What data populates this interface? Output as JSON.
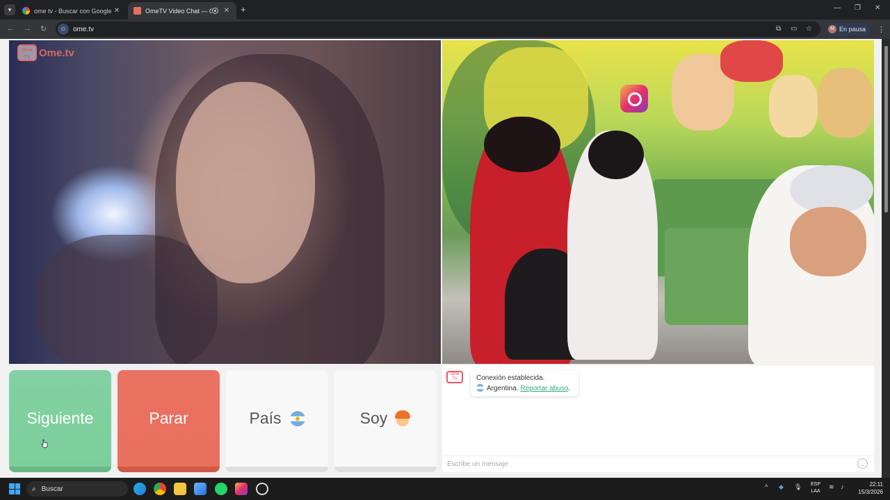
{
  "browser": {
    "tabs": [
      {
        "title": "ome tv - Buscar con Google",
        "active": false
      },
      {
        "title": "OmeTV Video Chat — Ome",
        "active": true
      }
    ],
    "url": "ome.tv",
    "profile_label": "En pausa",
    "profile_initial": "M"
  },
  "site": {
    "logo_text": "Ome.tv",
    "logo_badge": "Ome TV"
  },
  "controls": {
    "next_label": "Siguiente",
    "stop_label": "Parar",
    "country_label": "País",
    "gender_label": "Soy"
  },
  "chat": {
    "connection_text": "Conexión establecida.",
    "country_text": "Argentina.",
    "report_link": "Reportar abuso",
    "report_suffix": ".",
    "input_placeholder": "Escribe un mensaje"
  },
  "taskbar": {
    "search_placeholder": "Buscar",
    "lang_line1": "ESP",
    "lang_line2": "LAA",
    "time": "22:11",
    "date": "15/3/2026"
  },
  "colors": {
    "next": "#7ccf9a",
    "stop": "#e9705d",
    "link": "#3aa879"
  }
}
